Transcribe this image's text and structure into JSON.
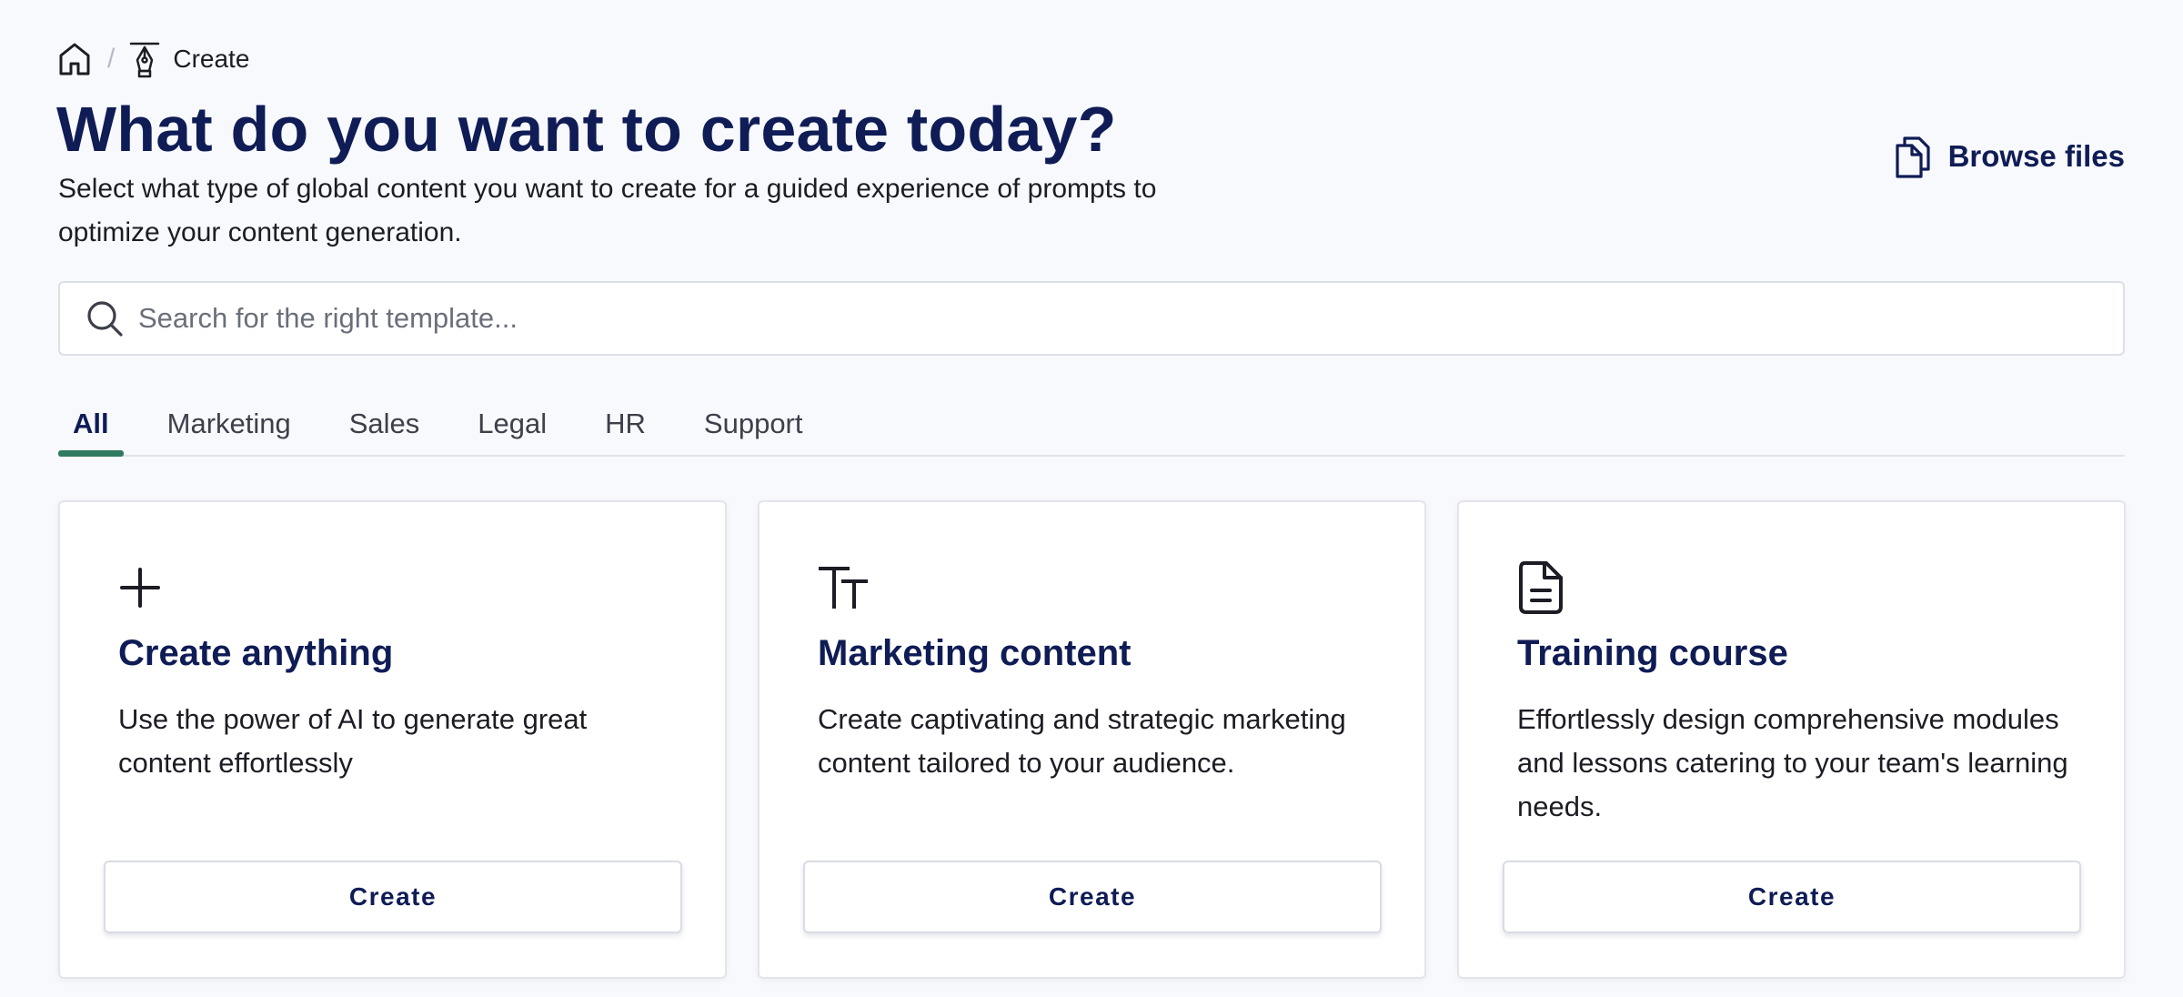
{
  "breadcrumb": {
    "home_icon": "home-icon",
    "separator": "/",
    "current_icon": "pen-tool-icon",
    "current_label": "Create"
  },
  "header": {
    "title": "What do you want to create today?",
    "subtitle": "Select what type of global content you want to create for a guided experience of prompts to optimize your content generation.",
    "browse_label": "Browse files",
    "browse_icon": "files-icon"
  },
  "search": {
    "placeholder": "Search for the right template...",
    "value": "",
    "icon": "search-icon"
  },
  "tabs": [
    {
      "label": "All",
      "active": true
    },
    {
      "label": "Marketing",
      "active": false
    },
    {
      "label": "Sales",
      "active": false
    },
    {
      "label": "Legal",
      "active": false
    },
    {
      "label": "HR",
      "active": false
    },
    {
      "label": "Support",
      "active": false
    }
  ],
  "cards": [
    {
      "icon": "plus-icon",
      "title": "Create anything",
      "description": "Use the power of AI to generate great content effortlessly",
      "button": "Create"
    },
    {
      "icon": "text-size-icon",
      "title": "Marketing content",
      "description": "Create captivating and strategic marketing content tailored to your audience.",
      "button": "Create"
    },
    {
      "icon": "document-icon",
      "title": "Training course",
      "description": "Effortlessly design comprehensive modules and lessons catering to your team's learning needs.",
      "button": "Create"
    }
  ],
  "colors": {
    "heading": "#0f1c55",
    "accent": "#2f7a60",
    "background": "#f8f9fd"
  }
}
